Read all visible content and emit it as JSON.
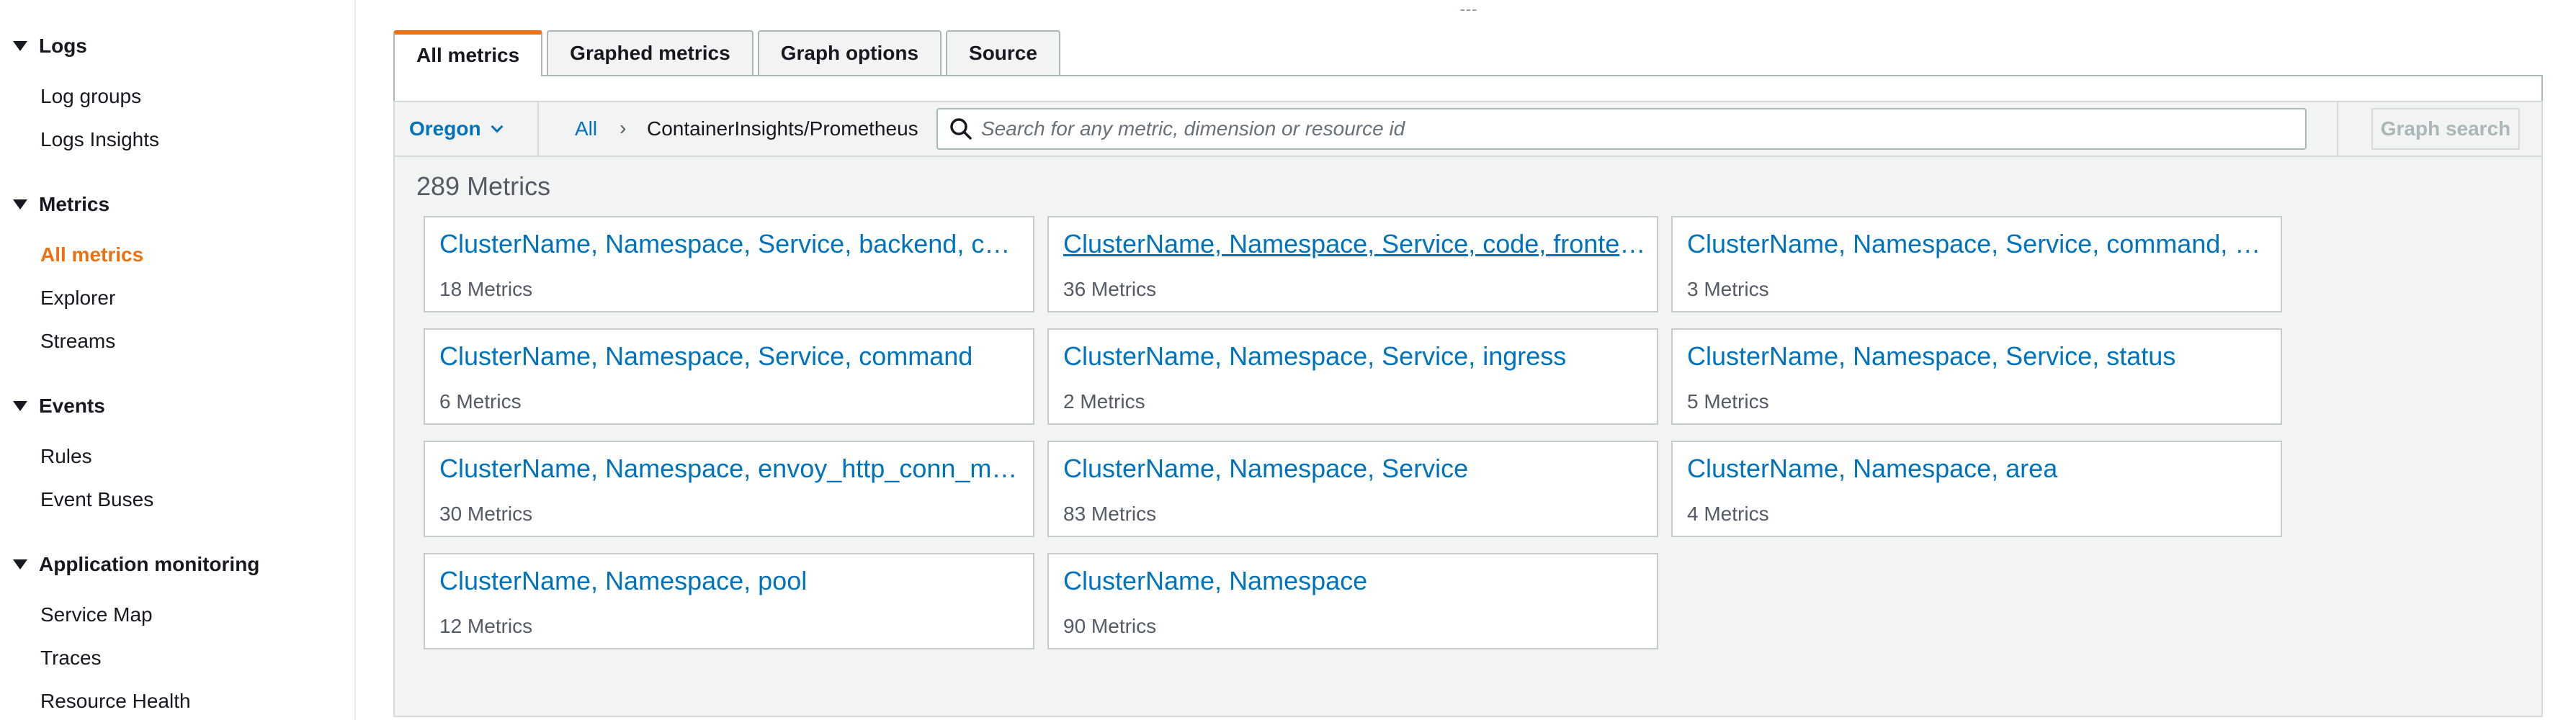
{
  "sidebar": {
    "sections": [
      {
        "title": "Logs",
        "items": [
          "Log groups",
          "Logs Insights"
        ]
      },
      {
        "title": "Metrics",
        "items": [
          "All metrics",
          "Explorer",
          "Streams"
        ]
      },
      {
        "title": "Events",
        "items": [
          "Rules",
          "Event Buses"
        ]
      },
      {
        "title": "Application monitoring",
        "items": [
          "Service Map",
          "Traces",
          "Resource Health"
        ]
      }
    ],
    "active_item": "All metrics"
  },
  "drag_handle": "---",
  "tabs": [
    {
      "label": "All metrics",
      "active": true
    },
    {
      "label": "Graphed metrics",
      "active": false
    },
    {
      "label": "Graph options",
      "active": false
    },
    {
      "label": "Source",
      "active": false
    }
  ],
  "toolbar": {
    "region": "Oregon",
    "breadcrumb_root": "All",
    "breadcrumb_separator": "›",
    "breadcrumb_current": "ContainerInsights/Prometheus",
    "search_placeholder": "Search for any metric, dimension or resource id",
    "graph_search_label": "Graph search"
  },
  "metrics_count": "289 Metrics",
  "metric_groups": [
    {
      "title": "ClusterName, Namespace, Service, backend, code",
      "count": "18 Metrics"
    },
    {
      "title": "ClusterName, Namespace, Service, code, frontend",
      "count": "36 Metrics",
      "hovered": true
    },
    {
      "title": "ClusterName, Namespace, Service, command, status",
      "count": "3 Metrics"
    },
    {
      "title": "ClusterName, Namespace, Service, command",
      "count": "6 Metrics"
    },
    {
      "title": "ClusterName, Namespace, Service, ingress",
      "count": "2 Metrics"
    },
    {
      "title": "ClusterName, Namespace, Service, status",
      "count": "5 Metrics"
    },
    {
      "title": "ClusterName, Namespace, envoy_http_conn_manager_prefix",
      "count": "30 Metrics"
    },
    {
      "title": "ClusterName, Namespace, Service",
      "count": "83 Metrics"
    },
    {
      "title": "ClusterName, Namespace, area",
      "count": "4 Metrics"
    },
    {
      "title": "ClusterName, Namespace, pool",
      "count": "12 Metrics"
    },
    {
      "title": "ClusterName, Namespace",
      "count": "90 Metrics"
    }
  ],
  "colors": {
    "accent": "#ec7211",
    "link": "#0073bb",
    "panel_bg": "#f2f3f3"
  }
}
